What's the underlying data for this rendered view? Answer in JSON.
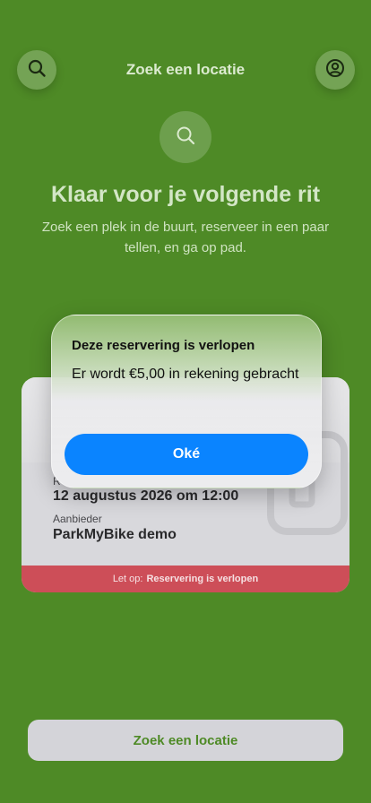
{
  "header": {
    "title": "Zoek een locatie",
    "left_icon": "search-icon",
    "right_icon": "user-profile-icon"
  },
  "hero": {
    "icon": "search-icon",
    "title": "Klaar voor je volgende rit",
    "subtitle": "Zoek een plek in de buurt, reserveer in een paar tellen, en ga op pad."
  },
  "reservation_card": {
    "date_label_partial": "R",
    "date_value": "12 augustus 2026 om 12:00",
    "provider_label": "Aanbieder",
    "provider_value": "ParkMyBike demo",
    "footer_prefix": "Let op:",
    "footer_status": "Reservering is verlopen"
  },
  "dialog": {
    "title": "Deze reservering is verlopen",
    "message": "Er wordt €5,00 in rekening gebracht",
    "ok_label": "Oké"
  },
  "bottom": {
    "button_label": "Zoek een locatie"
  },
  "colors": {
    "background": "#4e8a26",
    "accent_blue": "#0a84ff",
    "alert_red": "#cd4e58"
  }
}
